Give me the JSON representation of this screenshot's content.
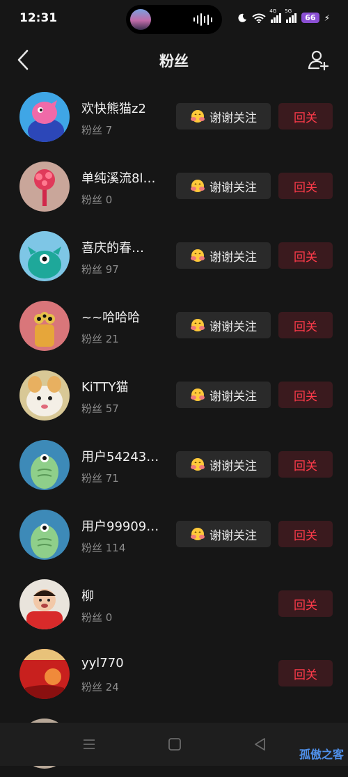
{
  "status_bar": {
    "time": "12:31",
    "signal_1": "4G",
    "signal_2": "5G",
    "battery": "66"
  },
  "header": {
    "title": "粉丝"
  },
  "thank_label": "谢谢关注",
  "follow_back_label": "回关",
  "fans": [
    {
      "name": "欢快熊猫z2",
      "fans": "粉丝 7",
      "has_thank": true
    },
    {
      "name": "单纯溪流8l…",
      "fans": "粉丝 0",
      "has_thank": true
    },
    {
      "name": "喜庆的春…",
      "fans": "粉丝 97",
      "has_thank": true
    },
    {
      "name": "~~哈哈哈",
      "fans": "粉丝 21",
      "has_thank": true
    },
    {
      "name": "KiTTY猫",
      "fans": "粉丝 57",
      "has_thank": true
    },
    {
      "name": "用户54243…",
      "fans": "粉丝 71",
      "has_thank": true
    },
    {
      "name": "用户99909…",
      "fans": "粉丝 114",
      "has_thank": true
    },
    {
      "name": "柳",
      "fans": "粉丝 0",
      "has_thank": false
    },
    {
      "name": "yyl770",
      "fans": "粉丝 24",
      "has_thank": false
    }
  ],
  "watermark": "孤傲之客",
  "colors": {
    "follow_red": "#ff3b4a",
    "follow_bg": "#3a1a1e",
    "battery": "#8b4fd4"
  }
}
